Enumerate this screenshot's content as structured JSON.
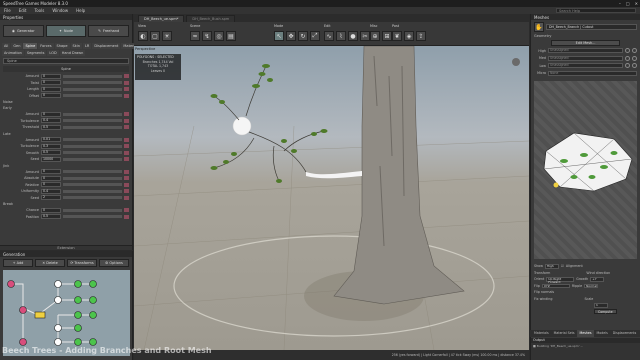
{
  "window": {
    "title": "SpeedTree Games Modeler 8.3.0",
    "controls": [
      "–",
      "□",
      "✕"
    ]
  },
  "menu": [
    "File",
    "Edit",
    "Tools",
    "Window",
    "Help"
  ],
  "search_help": {
    "placeholder": "Search Help"
  },
  "properties": {
    "header": "Properties",
    "modes": [
      {
        "label": "Generator"
      },
      {
        "label": "Node"
      },
      {
        "label": "Freehand"
      }
    ],
    "tabs_row1": [
      "All",
      "Gen",
      "Spine",
      "Forces",
      "Shape",
      "Skin",
      "LR",
      "Displacement",
      "Material"
    ],
    "tabs_row2": [
      "Animation",
      "Segments",
      "LOD",
      "Hand Drawn"
    ],
    "object_name": "Spine",
    "column_header": "Spine",
    "rows": [
      {
        "section": "",
        "label": "Amount",
        "value": "0"
      },
      {
        "section": "",
        "label": "Twist",
        "value": "0"
      },
      {
        "section": "",
        "label": "Length",
        "value": "0"
      },
      {
        "section": "",
        "label": "Offset",
        "value": "0"
      },
      {
        "section": "Noise",
        "label": "",
        "value": ""
      },
      {
        "section": "Early",
        "label": "",
        "value": ""
      },
      {
        "section": "",
        "label": "Amount",
        "value": "0"
      },
      {
        "section": "",
        "label": "Turbulence",
        "value": "0.4"
      },
      {
        "section": "",
        "label": "Threshold",
        "value": "0.5"
      },
      {
        "section": "Late",
        "label": "",
        "value": ""
      },
      {
        "section": "",
        "label": "Amount",
        "value": "0.01"
      },
      {
        "section": "",
        "label": "Turbulence",
        "value": "0.3"
      },
      {
        "section": "",
        "label": "Smooth",
        "value": "0.5"
      },
      {
        "section": "",
        "label": "Seed",
        "value": "10000"
      },
      {
        "section": "Jink",
        "label": "",
        "value": ""
      },
      {
        "section": "",
        "label": "Amount",
        "value": "0"
      },
      {
        "section": "",
        "label": "Absolute",
        "value": "0"
      },
      {
        "section": "",
        "label": "Relative",
        "value": "0"
      },
      {
        "section": "",
        "label": "Uniformity",
        "value": "0.4"
      },
      {
        "section": "",
        "label": "Seed",
        "value": "2"
      },
      {
        "section": "Break",
        "label": "",
        "value": ""
      },
      {
        "section": "",
        "label": "Chance",
        "value": "0"
      },
      {
        "section": "",
        "label": "Position",
        "value": "0.5"
      }
    ],
    "rollout": "Extension"
  },
  "generation": {
    "header": "Generation",
    "buttons": [
      "Add",
      "Delete",
      "Transforms",
      "Options"
    ]
  },
  "doc_tabs": [
    {
      "label": "DH_Beech_ue.spm*",
      "active": true
    },
    {
      "label": "DH_Beech_Bush.spm",
      "active": false
    }
  ],
  "toolbar_groups": [
    "View",
    "Scene",
    "Mode",
    "Edit",
    "Misc",
    "Post"
  ],
  "viewport": {
    "caption": "Perspective",
    "stats_title": "POLYGONS : SELECTED",
    "stats_lines": [
      "Branches 1,744 Vol",
      "TOTAL 1,743",
      "Leaves 0"
    ]
  },
  "status_text": "256 (yes forward) | Light Cornerfall | 47 tick Sway (ms) 100.00 ms | distance 37.4%",
  "video_overlay": "Beech Trees - Adding Branches and Root Mesh",
  "meshes": {
    "header": "Meshes",
    "current": "DH_Beech_Branch | Cutout",
    "geometry_label": "Geometry",
    "edit_button": "Edit Mesh...",
    "lods": [
      {
        "label": "High",
        "value": "Unassigned"
      },
      {
        "label": "Med",
        "value": "Unassigned"
      },
      {
        "label": "Low",
        "value": "Unassigned"
      },
      {
        "label": "Micro",
        "value": "None"
      }
    ],
    "controls": {
      "show_label": "Show",
      "show_value": "High",
      "alignment_label": "Alignment",
      "transform_label": "Transform",
      "orient_label": "Orient",
      "orient_value": "Up Right Forward",
      "flip_label": "Flip",
      "flip_value": "XYZ",
      "flip_normals": "Flip normals",
      "fix_winding": "Fix winding",
      "wind_label": "Wind direction",
      "growth_label": "Growth",
      "growth_value": "+Y",
      "ripple_label": "Ripple",
      "ripple_value": "Normal",
      "scale_label": "Scale",
      "scale_value": "1",
      "compute_button": "Compute"
    }
  },
  "right_tabs": [
    "Materials",
    "Material Sets",
    "Meshes",
    "Models",
    "Displacements"
  ],
  "output": {
    "header": "Output",
    "text": "■ Building 'DH_Beech_ue.spm' ..."
  }
}
